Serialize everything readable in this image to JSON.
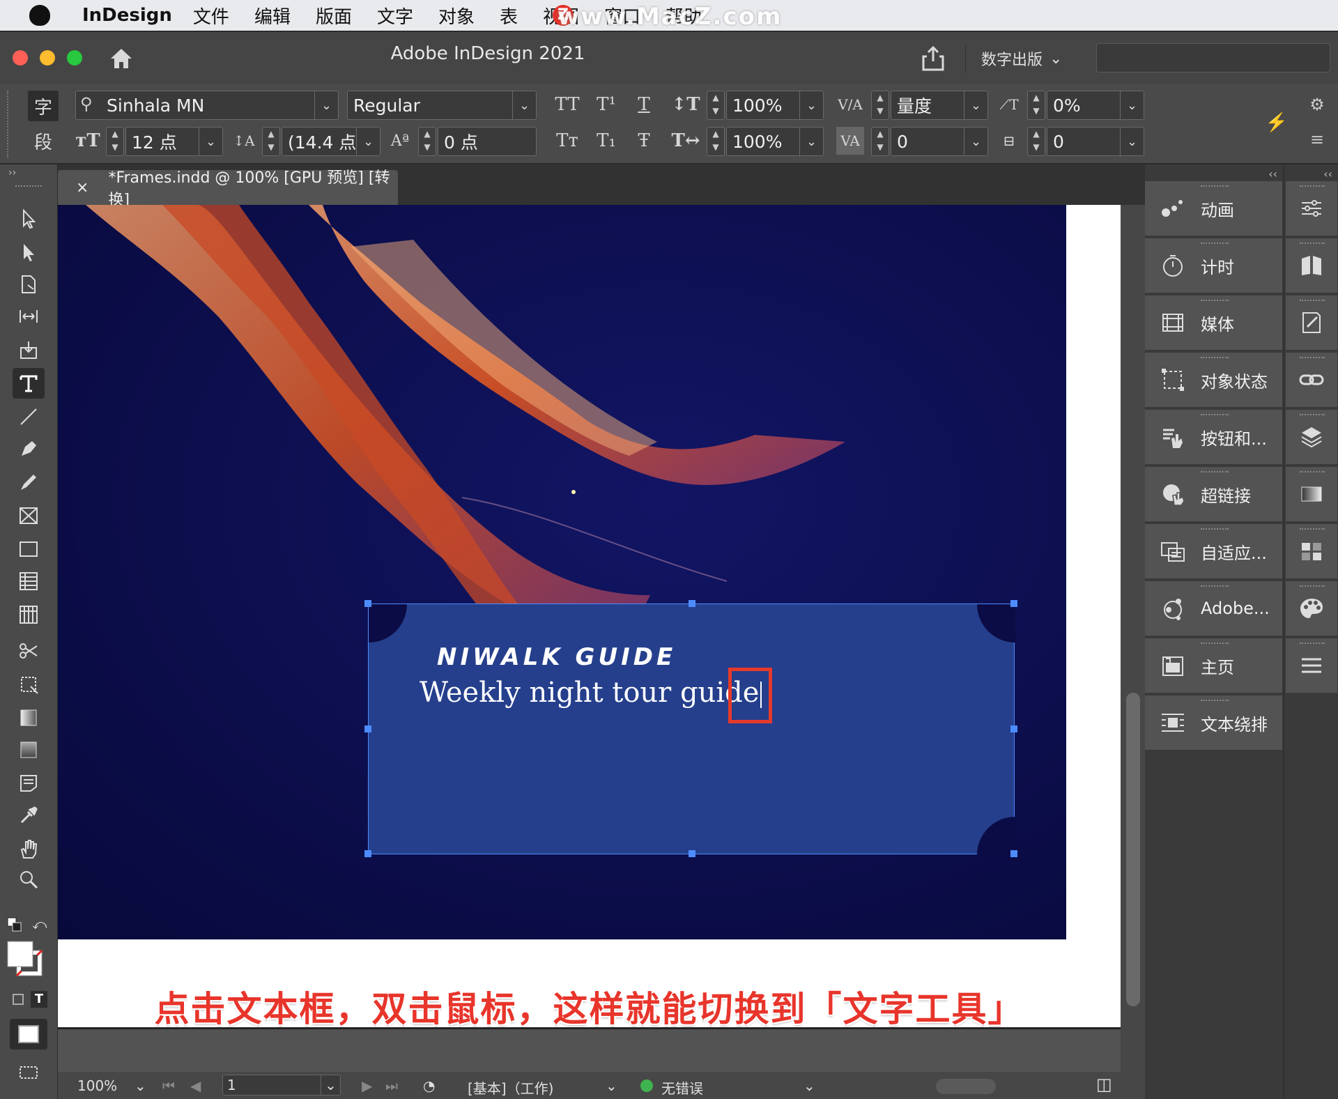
{
  "menubar": {
    "app_name": "InDesign",
    "items": [
      "文件",
      "编辑",
      "版面",
      "文字",
      "对象",
      "表",
      "视图",
      "窗口",
      "帮助"
    ],
    "watermark": "www.MacZ.com",
    "watermark_logo": "Z"
  },
  "titlebar": {
    "title": "Adobe InDesign 2021",
    "workspace_label": "数字出版",
    "traffic_colors": [
      "#fe5f57",
      "#febc2e",
      "#28c840"
    ]
  },
  "control_panel": {
    "mode_char": "字",
    "mode_para": "段",
    "font_family": "Sinhala MN",
    "font_style": "Regular",
    "font_size": "12 点",
    "leading": "(14.4 点",
    "baseline_shift": "0 点",
    "vertical_scale": "100%",
    "horizontal_scale": "100%",
    "kerning": "量度",
    "tracking": "0",
    "skew": "0%",
    "char_rotation": "0",
    "style_buttons_row1": [
      "TT",
      "T¹",
      "T"
    ],
    "style_buttons_row2": [
      "Tт",
      "T₁",
      "Ŧ"
    ]
  },
  "document_tab": {
    "close": "×",
    "label": "*Frames.indd @ 100% [GPU 预览] [转换]"
  },
  "textframe": {
    "heading": "NIWALK GUIDE",
    "body": "Weekly night tour guide"
  },
  "caption": "点击文本框，双击鼠标，这样就能切换到「文字工具」",
  "statusbar": {
    "zoom": "100%",
    "page": "1",
    "master": "[基本]（工作)",
    "preflight": "无错误",
    "preflight_color": "#3fb34f"
  },
  "panels": [
    {
      "label": "动画",
      "icon": "animation-icon"
    },
    {
      "label": "计时",
      "icon": "timing-icon"
    },
    {
      "label": "媒体",
      "icon": "media-icon"
    },
    {
      "label": "对象状态",
      "icon": "object-states-icon"
    },
    {
      "label": "按钮和...",
      "icon": "buttons-icon"
    },
    {
      "label": "超链接",
      "icon": "hyperlinks-icon"
    },
    {
      "label": "自适应...",
      "icon": "liquid-layout-icon"
    },
    {
      "label": "Adobe...",
      "icon": "adobe-cc-icon"
    },
    {
      "label": "主页",
      "icon": "pages-icon"
    },
    {
      "label": "文本绕排",
      "icon": "text-wrap-icon"
    }
  ],
  "accent_color": "#4d8cff",
  "highlight_color": "#e53a2b"
}
